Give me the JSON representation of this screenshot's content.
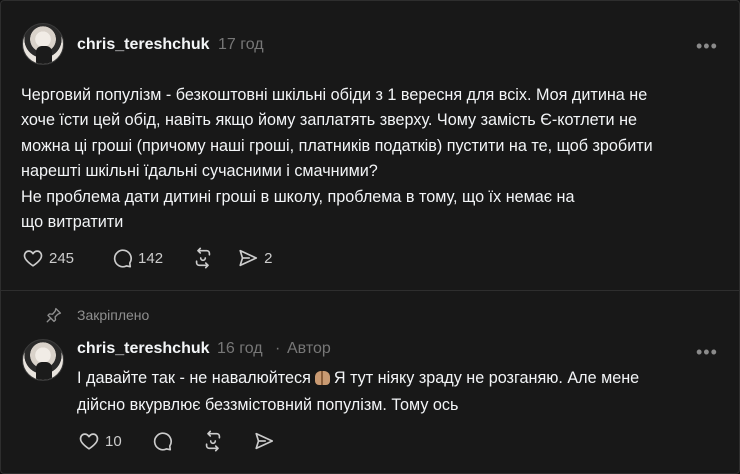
{
  "post": {
    "username": "chris_tereshchuk",
    "time": "17 год",
    "more_label": "•••",
    "text_lines": [
      "Черговий популізм - безкоштовні шкільні обіди з 1 вересня для всіх. Моя дитина не",
      "хоче їсти цей обід, навіть якщо йому заплатять зверху. Чому замість Є-котлети не",
      "можна ці гроші (причому наші гроші, платників податків) пустити на те, щоб зробити",
      "нарешті шкільні їдальні сучасними і смачними?",
      "Не проблема дати дитині гроші в школу, проблема в тому, що їх немає на",
      "що витратити"
    ],
    "likes": "245",
    "comments": "142",
    "shares": "2"
  },
  "pinned_label": "Закріплено",
  "reply": {
    "username": "chris_tereshchuk",
    "time": "16 год",
    "separator": "·",
    "author_badge": "Автор",
    "more_label": "•••",
    "line1_a": "І давайте так - не навалюйтеся",
    "line1_b": "Я тут ніяку зраду не розганяю. Але мене",
    "line2": "дійсно вкурвлює беззмістовний популізм. Тому ось",
    "likes": "10"
  },
  "icons": {
    "like": "heart-icon",
    "comment": "comment-bubble-icon",
    "repost": "repost-icon",
    "share": "send-icon",
    "pin": "pin-icon",
    "emoji": "raising-hands-emoji"
  }
}
